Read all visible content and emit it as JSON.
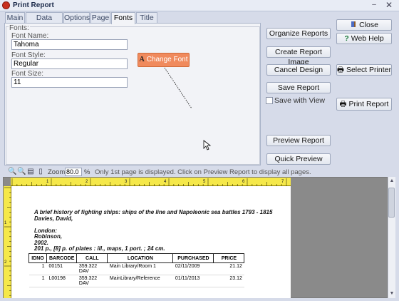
{
  "window": {
    "title": "Print Report",
    "minimize": "–",
    "close": "✕"
  },
  "tabs": [
    {
      "label": "Main"
    },
    {
      "label": "Data Fields"
    },
    {
      "label": "Options"
    },
    {
      "label": "Page"
    },
    {
      "label": "Fonts"
    },
    {
      "label": "Title"
    }
  ],
  "fonts_panel": {
    "legend": "Fonts:",
    "font_name_label": "Font Name:",
    "font_name_value": "Tahoma",
    "font_style_label": "Font Style:",
    "font_style_value": "Regular",
    "font_size_label": "Font Size:",
    "font_size_value": "11",
    "change_font_label": "Change Font",
    "change_font_glyph": "A"
  },
  "actions": {
    "organize_reports": "Organize Reports",
    "create_report_image": "Create Report Image",
    "cancel_design": "Cancel Design",
    "save_report": "Save Report",
    "save_with_view": "Save with View",
    "preview_report": "Preview Report",
    "quick_preview": "Quick Preview",
    "close": "Close",
    "web_help": "Web Help",
    "select_printer": "Select Printer",
    "print_report": "Print Report"
  },
  "toolbar": {
    "zoom_label": "Zoom",
    "zoom_value": "80.0",
    "zoom_unit": "%",
    "message": "Only 1st page is displayed. Click on Preview Report to display all pages."
  },
  "report": {
    "title_line1": "A brief history of fighting ships: ships of the line and Napoleonic sea battles 1793 - 1815",
    "title_line2": "Davies, David,",
    "publisher_city": "London:",
    "publisher": "Robinson,",
    "year": "2002.",
    "physical": "201 p., [8] p. of plates :  ill., maps, 1 port. ;   24 cm.",
    "columns": [
      "IDNO",
      "BARCODE",
      "CALL",
      "LOCATION",
      "PURCHASED",
      "PRICE"
    ],
    "rows": [
      {
        "idno": "1",
        "barcode": "00151",
        "call1": "359.322",
        "call2": "DAV",
        "location": "Main Library/Room 1",
        "purchased": "02/11/2009",
        "price": "21.12"
      },
      {
        "idno": "1",
        "barcode": "L00198",
        "call1": "359.322",
        "call2": "DAV",
        "location": "MainLibrary/Reference",
        "purchased": "01/11/2013",
        "price": "23.12"
      }
    ]
  },
  "ruler_numbers_top": [
    "1",
    "2",
    "3",
    "4",
    "5",
    "6",
    "7"
  ],
  "ruler_numbers_left": [
    "1",
    "2",
    "3"
  ],
  "colors": {
    "accent": "#f08a5d",
    "ruler": "#f5e84a",
    "panel": "#f2f3f7",
    "background": "#d6dbe9"
  }
}
